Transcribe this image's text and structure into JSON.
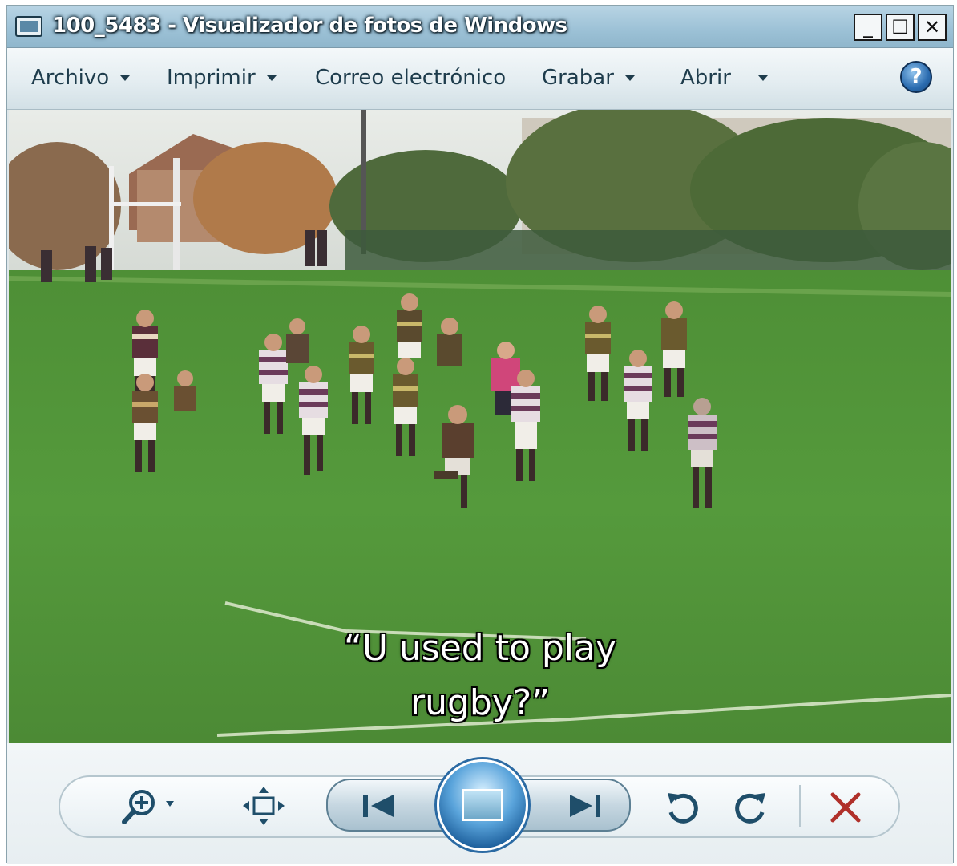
{
  "window": {
    "title": "100_5483 - Visualizador de fotos de Windows",
    "controls": {
      "minimize": "_",
      "maximize": "☐",
      "close": "✕"
    }
  },
  "menu": {
    "items": [
      {
        "label": "Archivo",
        "has_dropdown": true
      },
      {
        "label": "Imprimir",
        "has_dropdown": true
      },
      {
        "label": "Correo electrónico",
        "has_dropdown": false
      },
      {
        "label": "Grabar",
        "has_dropdown": true
      },
      {
        "label": "Abrir",
        "has_dropdown": true
      }
    ],
    "help_label": "?"
  },
  "photo": {
    "caption_line1": "“U used to play",
    "caption_line2": "rugby?”"
  },
  "toolbar": {
    "icons": [
      "zoom-icon",
      "fit-window-icon",
      "previous-icon",
      "slideshow-icon",
      "next-icon",
      "rotate-left-icon",
      "rotate-right-icon",
      "delete-icon"
    ],
    "delete_color": "#b0302a"
  },
  "colors": {
    "titlebar": "#9cc1d6",
    "accent": "#2b6aa3",
    "grass": "#4f8e3a"
  }
}
